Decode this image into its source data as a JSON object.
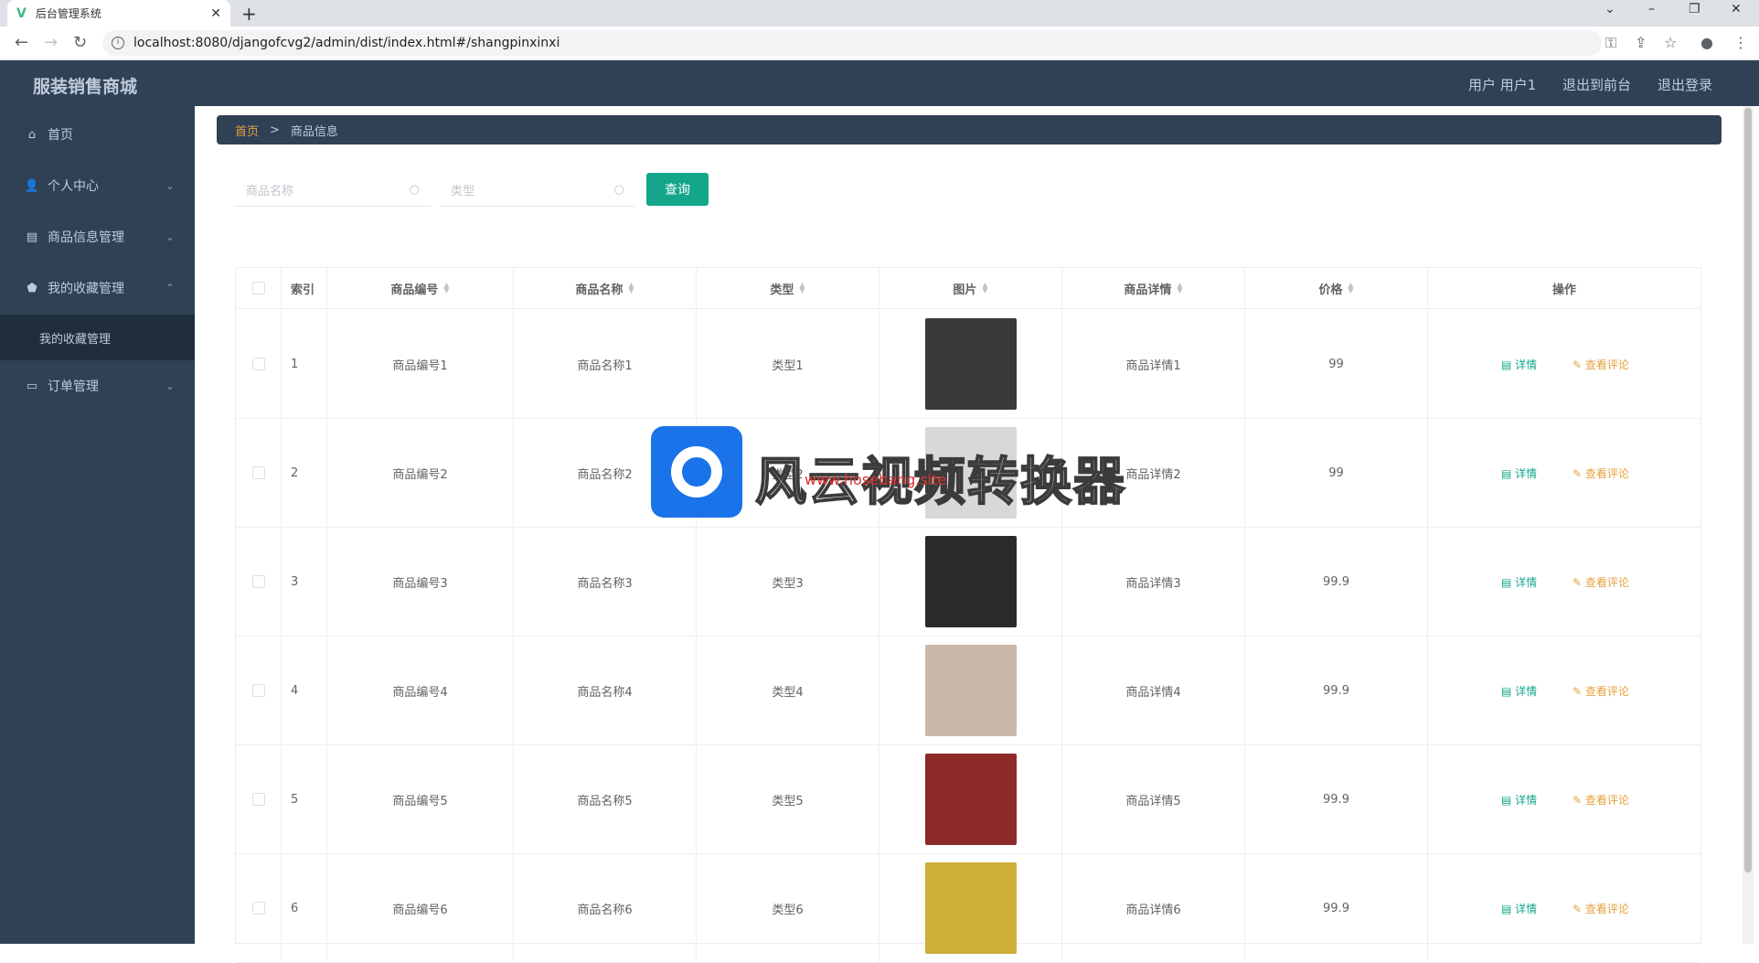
{
  "browser": {
    "tab_title": "后台管理系统",
    "url": "localhost:8080/djangofcvg2/admin/dist/index.html#/shangpinxinxi"
  },
  "header": {
    "brand": "服装销售商城",
    "user_label": "用户 用户1",
    "back_front": "退出到前台",
    "logout": "退出登录"
  },
  "sidebar": {
    "items": [
      {
        "label": "首页",
        "icon": "home-icon"
      },
      {
        "label": "个人中心",
        "icon": "user-icon"
      },
      {
        "label": "商品信息管理",
        "icon": "clipboard-icon"
      },
      {
        "label": "我的收藏管理",
        "icon": "shield-icon"
      },
      {
        "label": "订单管理",
        "icon": "order-icon"
      }
    ],
    "sub_item": "我的收藏管理"
  },
  "breadcrumb": {
    "home": "首页",
    "sep": ">",
    "current": "商品信息"
  },
  "search": {
    "name_placeholder": "商品名称",
    "type_placeholder": "类型",
    "button": "查询"
  },
  "table": {
    "headers": [
      "索引",
      "商品编号",
      "商品名称",
      "类型",
      "图片",
      "商品详情",
      "价格",
      "操作"
    ],
    "detail_label": "详情",
    "review_label": "查看评论",
    "rows": [
      {
        "index": "1",
        "code": "商品编号1",
        "name": "商品名称1",
        "type": "类型1",
        "detail": "商品详情1",
        "price": "99",
        "img": "#3a3a3a"
      },
      {
        "index": "2",
        "code": "商品编号2",
        "name": "商品名称2",
        "type": "类型2",
        "detail": "商品详情2",
        "price": "99",
        "img": "#d8d8d8"
      },
      {
        "index": "3",
        "code": "商品编号3",
        "name": "商品名称3",
        "type": "类型3",
        "detail": "商品详情3",
        "price": "99.9",
        "img": "#2a2a2a"
      },
      {
        "index": "4",
        "code": "商品编号4",
        "name": "商品名称4",
        "type": "类型4",
        "detail": "商品详情4",
        "price": "99.9",
        "img": "#c9b9a8"
      },
      {
        "index": "5",
        "code": "商品编号5",
        "name": "商品名称5",
        "type": "类型5",
        "detail": "商品详情5",
        "price": "99.9",
        "img": "#8c2a2a"
      },
      {
        "index": "6",
        "code": "商品编号6",
        "name": "商品名称6",
        "type": "类型6",
        "detail": "商品详情6",
        "price": "99.9",
        "img": "#cfae3a"
      }
    ]
  },
  "watermark": {
    "text": "风云视频转换器",
    "url": "www.hosebang.site"
  }
}
